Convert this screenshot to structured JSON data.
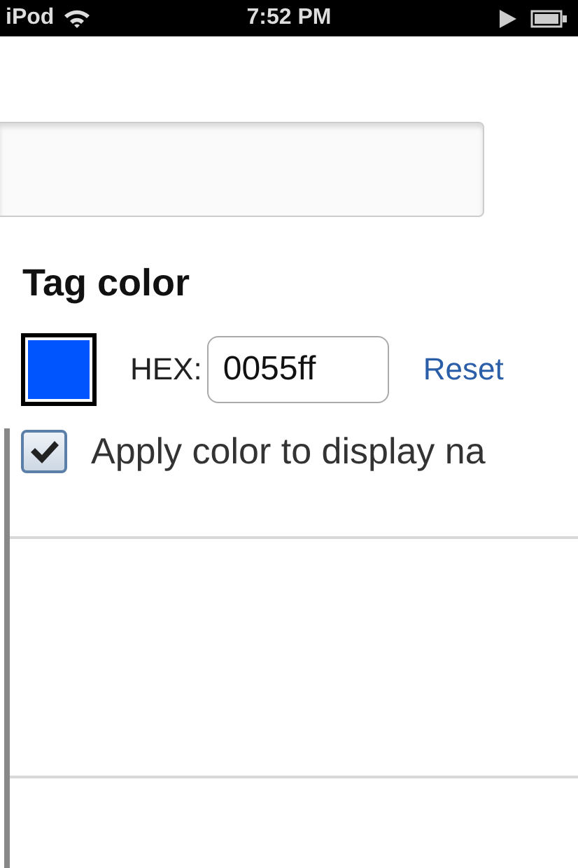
{
  "status_bar": {
    "carrier": "iPod",
    "time": "7:52 PM"
  },
  "tag_color": {
    "title": "Tag color",
    "hex_label": "HEX:",
    "hex_value": "0055ff",
    "reset": "Reset"
  },
  "apply_option": {
    "label": "Apply color to display na",
    "checked": true
  }
}
